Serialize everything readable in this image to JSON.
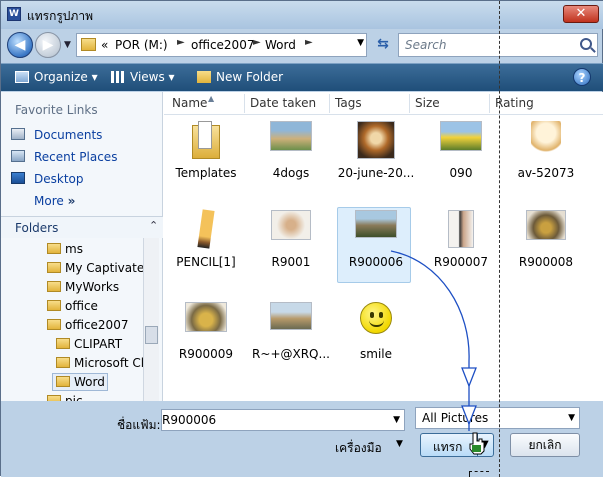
{
  "window": {
    "title": "แทรกรูปภาพ",
    "close": "✕",
    "icon_label": "W"
  },
  "address": {
    "crumbs": [
      "«",
      "POR (M:)",
      "office2007",
      "Word"
    ],
    "search_placeholder": "Search"
  },
  "toolbar": {
    "organize": "Organize",
    "views": "Views",
    "new_folder": "New Folder",
    "help": "?"
  },
  "nav": {
    "favorites_title": "Favorite Links",
    "favorites": [
      "Documents",
      "Recent Places",
      "Desktop",
      "More"
    ],
    "more_glyph": "»",
    "folders_title": "Folders",
    "tree": [
      "ms",
      "My Captivate P",
      "MyWorks",
      "office",
      "office2007",
      "CLIPART",
      "Microsoft Cli",
      "Word",
      "pic"
    ]
  },
  "columns": [
    "Name",
    "Date taken",
    "Tags",
    "Size",
    "Rating"
  ],
  "files": [
    {
      "name": "Templates",
      "icon": "folder-icon"
    },
    {
      "name": "4dogs",
      "icon": "photo-icon"
    },
    {
      "name": "20-june-20...",
      "icon": "photo-icon"
    },
    {
      "name": "090",
      "icon": "photo-icon"
    },
    {
      "name": "av-52073",
      "icon": "cartoon-icon"
    },
    {
      "name": "PENCIL[1]",
      "icon": "clipart-icon"
    },
    {
      "name": "R9001",
      "icon": "photo-icon"
    },
    {
      "name": "R900006",
      "icon": "photo-icon"
    },
    {
      "name": "R900007",
      "icon": "photo-icon"
    },
    {
      "name": "R900008",
      "icon": "photo-icon"
    },
    {
      "name": "R900009",
      "icon": "photo-icon"
    },
    {
      "name": "R~+@XRQ...",
      "icon": "photo-icon"
    },
    {
      "name": "smile",
      "icon": "smiley-icon"
    }
  ],
  "selected_file": "R900006",
  "bottom": {
    "filename_label": "ชื่อแฟ้ม:",
    "filename_value": "R900006",
    "filetype_value": "All Pictures",
    "tools_label": "เครื่องมือ",
    "insert_label": "แทรก",
    "cancel_label": "ยกเลิก"
  },
  "colors": {
    "toolbar": "#2a5a87",
    "link": "#0a3fa0",
    "selection": "#ddeefc",
    "annotation": "#1d4fc4"
  }
}
